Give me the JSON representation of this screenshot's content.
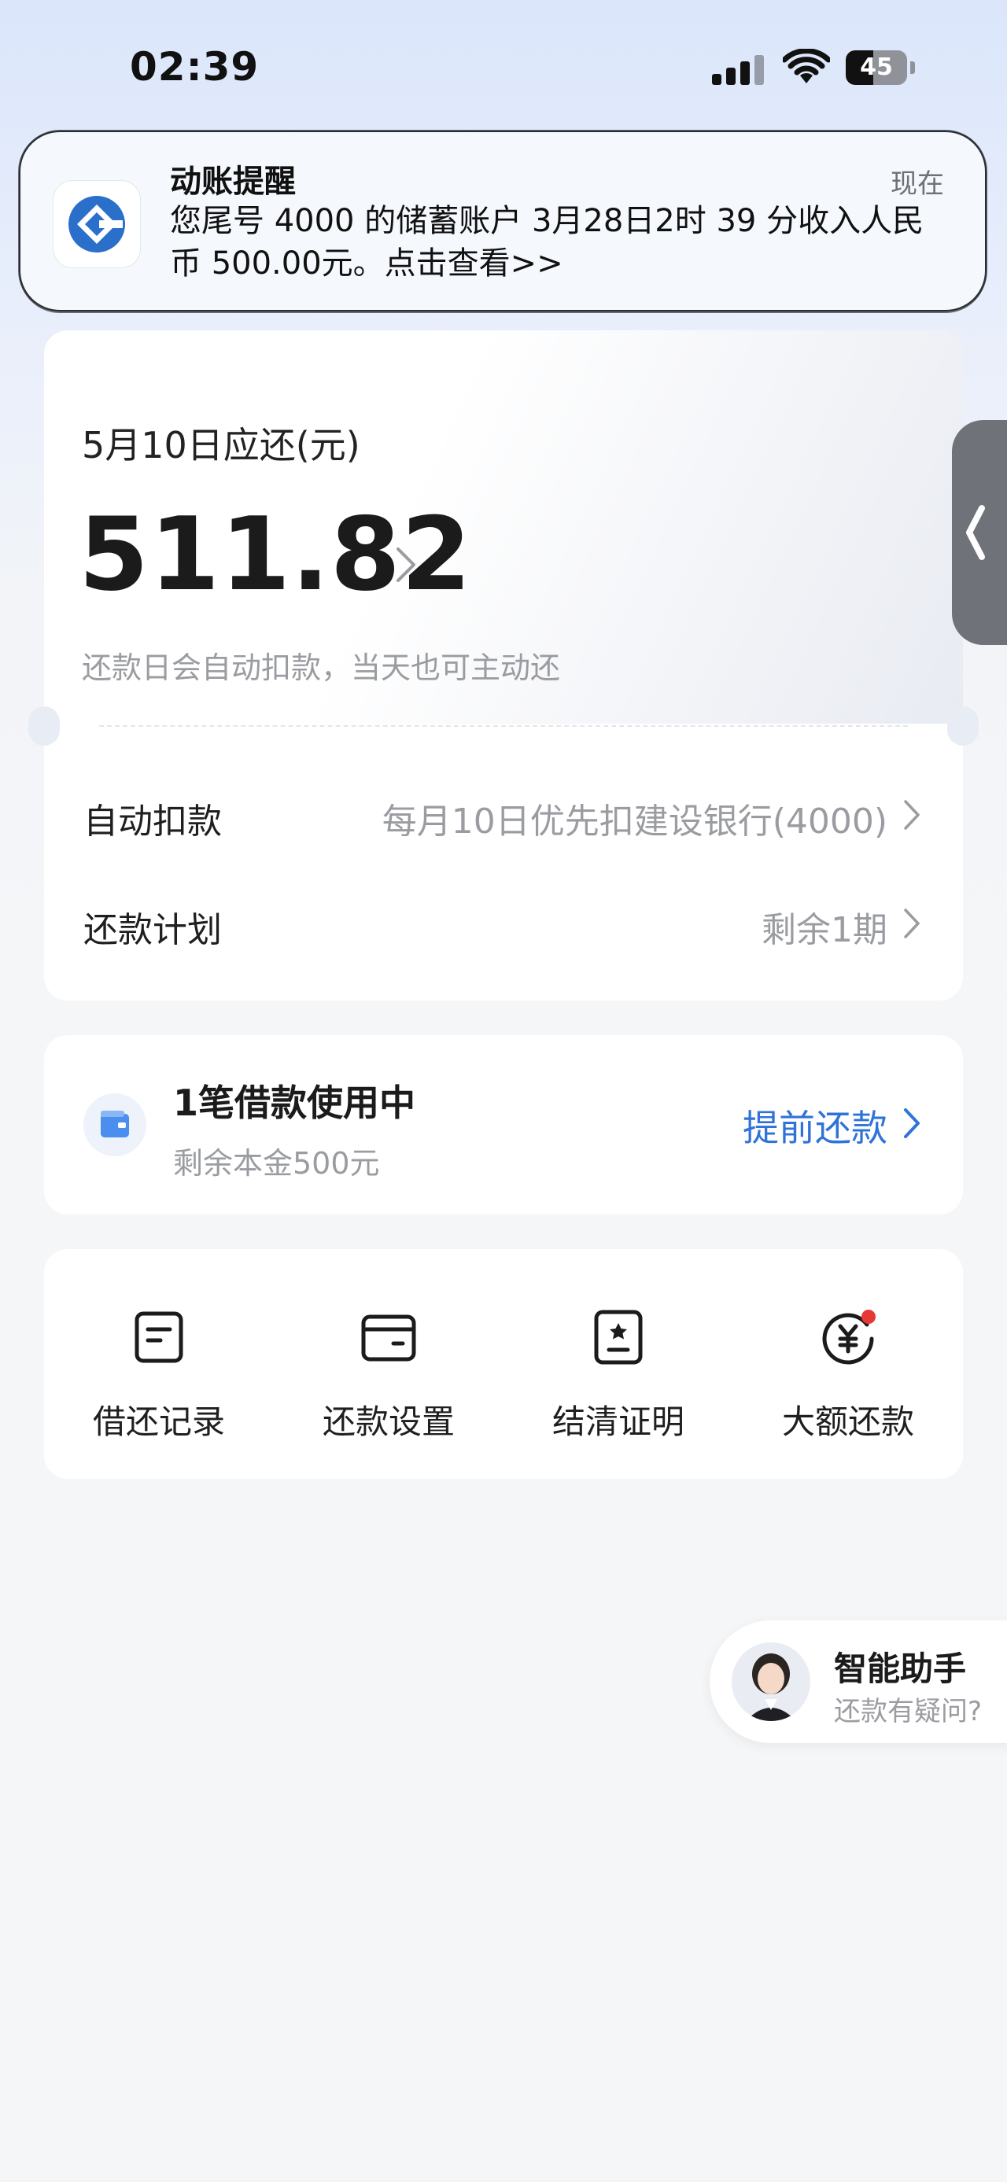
{
  "status_bar": {
    "time": "02:39",
    "battery_level": "45",
    "battery_percent": 45
  },
  "notification": {
    "title": "动账提醒",
    "time": "现在",
    "body": "您尾号 4000 的储蓄账户 3月28日2时 39 分收入人民币 500.00元。点击查看>>",
    "logo_icon": "bank-logo-icon"
  },
  "repayment": {
    "due_label": "5月10日应还(元)",
    "amount": "511.82",
    "hint": "还款日会自动扣款，当天也可主动还",
    "rows": [
      {
        "label": "自动扣款",
        "value": "每月10日优先扣建设银行(4000)"
      },
      {
        "label": "还款计划",
        "value": "剩余1期"
      }
    ]
  },
  "loan": {
    "title": "1笔借款使用中",
    "subtitle": "剩余本金500元",
    "action": "提前还款",
    "accent_color": "#2f73d9"
  },
  "actions": [
    {
      "label": "借还记录",
      "icon": "document-icon"
    },
    {
      "label": "还款设置",
      "icon": "card-icon"
    },
    {
      "label": "结清证明",
      "icon": "certificate-icon"
    },
    {
      "label": "大额还款",
      "icon": "yuan-icon",
      "badge": true
    }
  ],
  "assistant": {
    "title": "智能助手",
    "subtitle": "还款有疑问?"
  },
  "colors": {
    "accent": "#2f73d9",
    "muted_text": "#9a9ca1",
    "badge": "#e53935"
  }
}
